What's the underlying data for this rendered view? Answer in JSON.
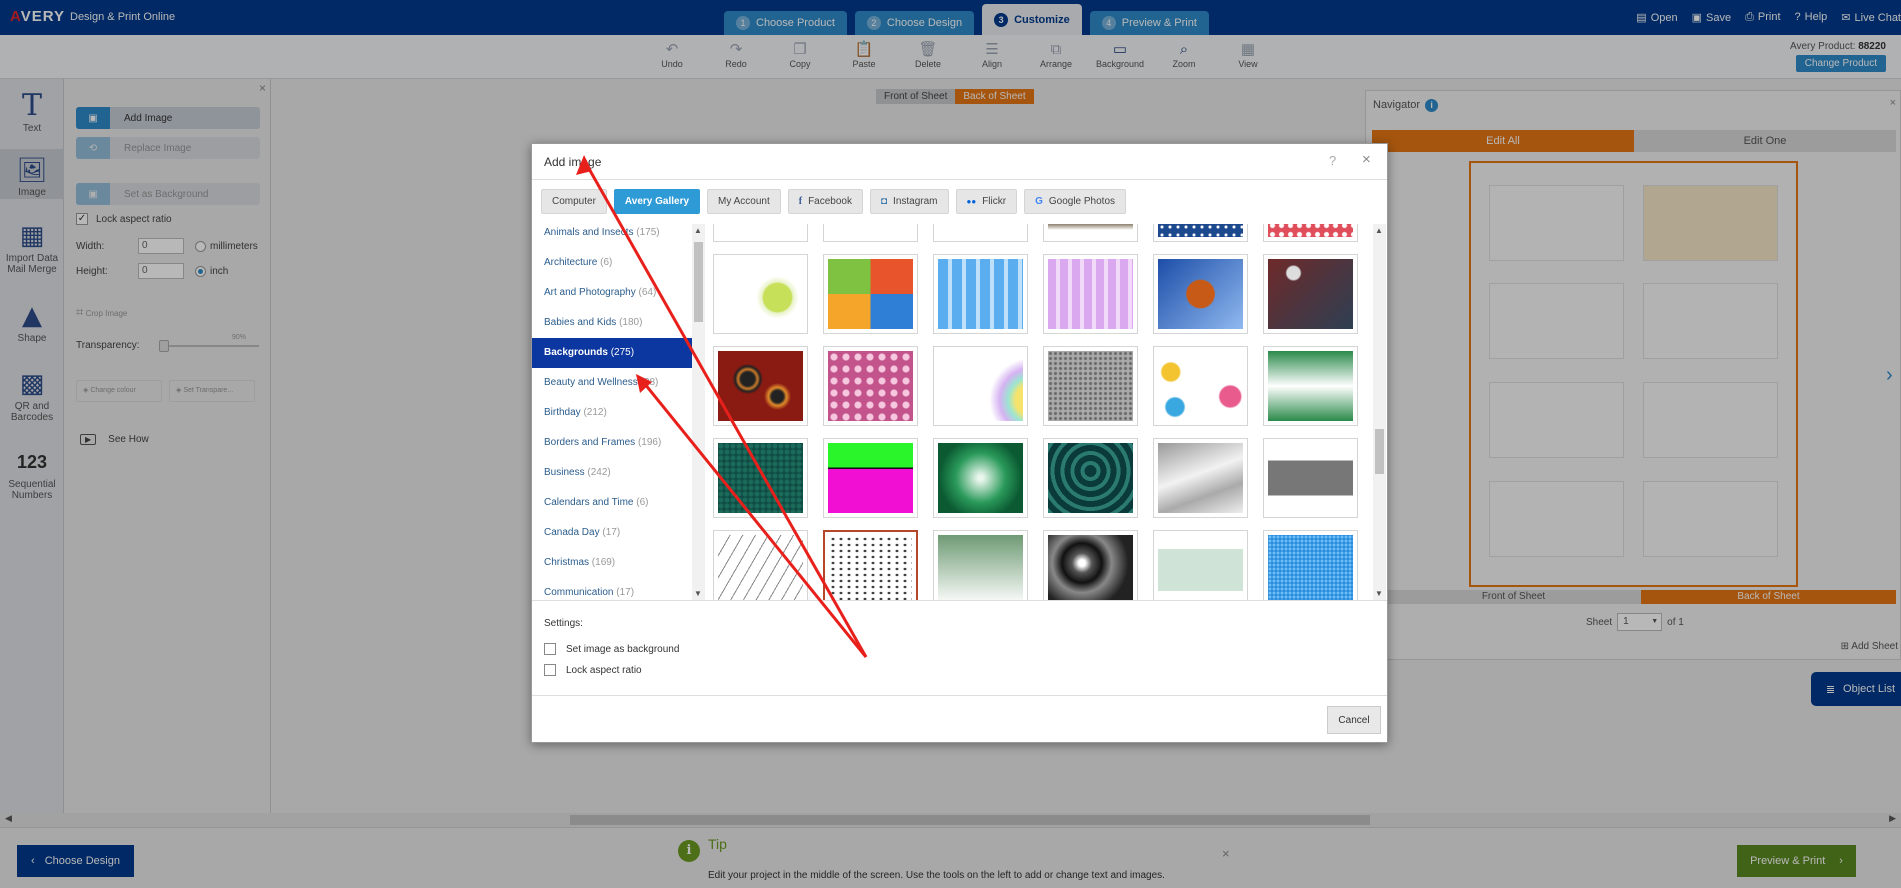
{
  "topbar": {
    "logo": "AVERY",
    "tagline": "Design & Print Online",
    "steps": [
      {
        "num": "1",
        "label": "Choose Product"
      },
      {
        "num": "2",
        "label": "Choose Design"
      },
      {
        "num": "3",
        "label": "Customize"
      },
      {
        "num": "4",
        "label": "Preview & Print"
      }
    ],
    "menu": [
      {
        "icon": "open-icon",
        "label": "Open"
      },
      {
        "icon": "save-icon",
        "label": "Save"
      },
      {
        "icon": "print-icon",
        "label": "Print"
      },
      {
        "icon": "help-icon",
        "label": "Help"
      },
      {
        "icon": "chat-icon",
        "label": "Live Chat"
      }
    ]
  },
  "toolbar": {
    "tools": [
      "Undo",
      "Redo",
      "Copy",
      "Paste",
      "Delete",
      "Align",
      "Arrange",
      "Background",
      "Zoom",
      "View"
    ],
    "product_label": "Avery Product:",
    "product_number": "88220",
    "change_product": "Change Product"
  },
  "leftbar": {
    "items": [
      "Text",
      "Image",
      "Import Data Mail Merge",
      "Shape",
      "QR and Barcodes",
      "Sequential Numbers"
    ],
    "text_glyph": "T",
    "seq_glyph": "123"
  },
  "panel": {
    "add_image": "Add Image",
    "replace_image": "Replace Image",
    "set_background": "Set as Background",
    "lock_aspect": "Lock aspect ratio",
    "width_label": "Width:",
    "height_label": "Height:",
    "width_value": "0",
    "height_value": "0",
    "unit_mm": "millimeters",
    "unit_inch": "inch",
    "crop_image": "Crop Image",
    "transparency": "Transparency:",
    "transparency_value": "90%",
    "change_colour": "Change colour",
    "set_transparent": "Set Transpare...",
    "see_how": "See How"
  },
  "canvas": {
    "front": "Front of Sheet",
    "back": "Back of Sheet"
  },
  "navigator": {
    "title": "Navigator",
    "edit_all": "Edit All",
    "edit_one": "Edit One",
    "front": "Front of Sheet",
    "back": "Back of Sheet",
    "sheet_label": "Sheet",
    "sheet_value": "1",
    "of_label": "of 1",
    "add_sheet": "Add Sheet",
    "object_list": "Object List"
  },
  "bottom": {
    "choose_design": "Choose Design",
    "tip_title": "Tip",
    "tip_text": "Edit your project in the middle of the screen. Use the tools on the left to add or change text and images.",
    "preview_print": "Preview & Print"
  },
  "modal": {
    "title": "Add image",
    "help": "?",
    "close": "×",
    "sources": [
      {
        "label": "Computer",
        "icon": ""
      },
      {
        "label": "Avery Gallery",
        "icon": ""
      },
      {
        "label": "My Account",
        "icon": ""
      },
      {
        "label": "Facebook",
        "icon": "f"
      },
      {
        "label": "Instagram",
        "icon": "◘"
      },
      {
        "label": "Flickr",
        "icon": "●●"
      },
      {
        "label": "Google Photos",
        "icon": "G"
      }
    ],
    "categories": [
      {
        "name": "Animals and Insects",
        "count": "(175)"
      },
      {
        "name": "Architecture",
        "count": "(6)"
      },
      {
        "name": "Art and Photography",
        "count": "(64)"
      },
      {
        "name": "Babies and Kids",
        "count": "(180)"
      },
      {
        "name": "Backgrounds",
        "count": "(275)"
      },
      {
        "name": "Beauty and Wellness",
        "count": "(28)"
      },
      {
        "name": "Birthday",
        "count": "(212)"
      },
      {
        "name": "Borders and Frames",
        "count": "(196)"
      },
      {
        "name": "Business",
        "count": "(242)"
      },
      {
        "name": "Calendars and Time",
        "count": "(6)"
      },
      {
        "name": "Canada Day",
        "count": "(17)"
      },
      {
        "name": "Christmas",
        "count": "(169)"
      },
      {
        "name": "Communication",
        "count": "(17)"
      }
    ],
    "settings_label": "Settings:",
    "set_background": "Set image as background",
    "lock_aspect": "Lock aspect ratio",
    "cancel": "Cancel"
  },
  "annotation_color": "#e8201c"
}
